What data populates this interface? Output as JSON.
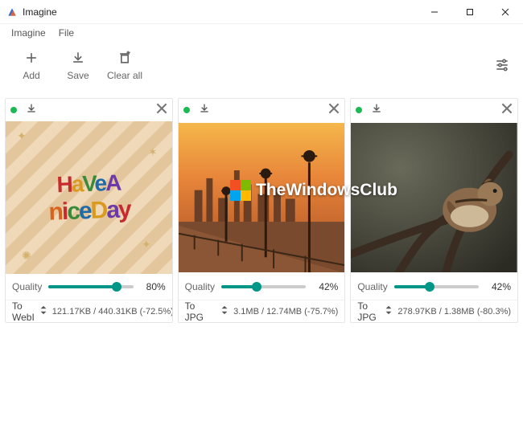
{
  "window": {
    "title": "Imagine"
  },
  "menu": {
    "items": [
      "Imagine",
      "File"
    ]
  },
  "toolbar": {
    "add_label": "Add",
    "save_label": "Save",
    "clear_label": "Clear all"
  },
  "cards": [
    {
      "status": "green",
      "quality_label": "Quality",
      "quality_value": "80%",
      "quality_pct": 80,
      "format": "To WebI",
      "sizes": "121.17KB / 440.31KB (-72.5%)",
      "art_line1": "HaVeA",
      "art_line2": "niceDay"
    },
    {
      "status": "green",
      "quality_label": "Quality",
      "quality_value": "42%",
      "quality_pct": 42,
      "format": "To JPG",
      "sizes": "3.1MB / 12.74MB (-75.7%)"
    },
    {
      "status": "green",
      "quality_label": "Quality",
      "quality_value": "42%",
      "quality_pct": 42,
      "format": "To JPG",
      "sizes": "278.97KB / 1.38MB (-80.3%)"
    }
  ],
  "watermark": {
    "text": "TheWindowsClub"
  }
}
